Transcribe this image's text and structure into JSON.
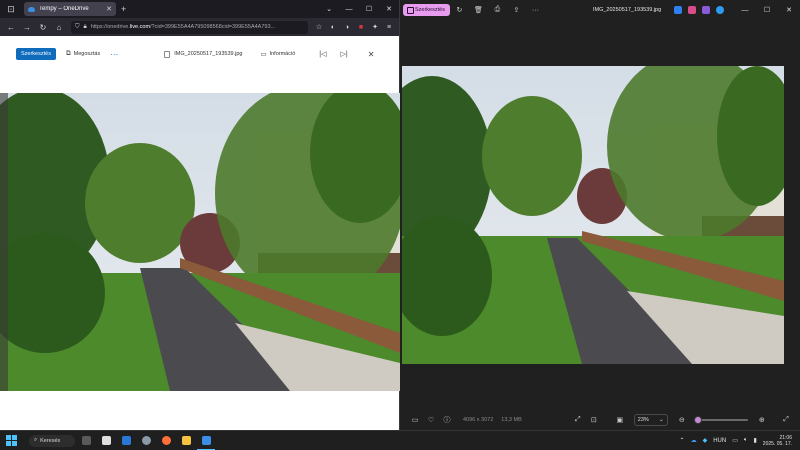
{
  "browser": {
    "tab_title": "Tempy – OneDrive",
    "url_prefix": "https://onedrive.",
    "url_domain": "live.com",
    "url_rest": "/?cid=399E55A4A795098568cid=399E55A4A793...",
    "toolbar": {
      "edit_label": "Szerkesztés",
      "share_label": "Megosztás",
      "more_label": "···",
      "file_name": "IMG_20250517_193539.jpg",
      "info_label": "Információ"
    }
  },
  "photos_app": {
    "edit_label": "Szerkesztés",
    "file_name": "IMG_20250517_193539.jpg",
    "dimensions": "4096 x 3072",
    "file_size": "13,3 MB",
    "zoom_value": "23%",
    "zoom_fraction": 0.05
  },
  "taskbar": {
    "search_label": "Keresés",
    "language": "HUN",
    "time": "21:06",
    "date": "2025. 05. 17."
  },
  "colors": {
    "onedrive_blue": "#0f6cbd",
    "photos_edit_pink": "#e89cf0",
    "slider_accent": "#c88ad6",
    "windows_accent": "#4cc2ff"
  }
}
